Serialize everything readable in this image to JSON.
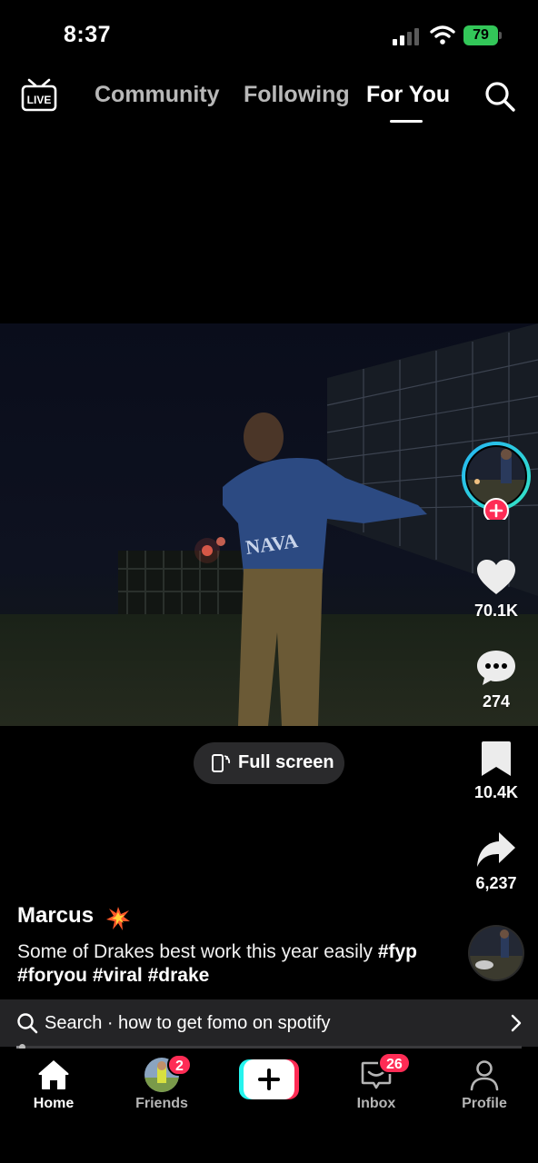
{
  "status_bar": {
    "time": "8:37",
    "battery": "79",
    "icons": [
      "signal-icon",
      "wifi-icon",
      "battery-charging-icon"
    ]
  },
  "top_nav": {
    "live_label": "LIVE",
    "tabs": [
      {
        "label": "Community",
        "active": false
      },
      {
        "label": "Following",
        "active": false
      },
      {
        "label": "For You",
        "active": true
      }
    ],
    "search_icon": "search-icon"
  },
  "video": {
    "fullscreen_label": "Full screen"
  },
  "actions": {
    "likes": "70.1K",
    "comments": "274",
    "saves": "10.4K",
    "shares": "6,237",
    "follow_icon": "plus-icon"
  },
  "post": {
    "author": "Marcus",
    "author_emoji": "💥",
    "caption_text": "Some of Drakes best work this year easily",
    "hashtags": [
      "#fyp",
      "#foryou",
      "#viral",
      "#drake"
    ]
  },
  "search_suggestion": {
    "prefix": "Search ·",
    "query": "how to get fomo on spotify"
  },
  "playback": {
    "progress": 0.01
  },
  "bottom_nav": {
    "home": "Home",
    "friends": "Friends",
    "friends_badge": "2",
    "create_icon": "plus-icon",
    "inbox": "Inbox",
    "inbox_badge": "26",
    "profile": "Profile"
  },
  "colors": {
    "accent_red": "#fe2c55",
    "accent_cyan": "#25f4ee",
    "battery_green": "#33c759"
  }
}
